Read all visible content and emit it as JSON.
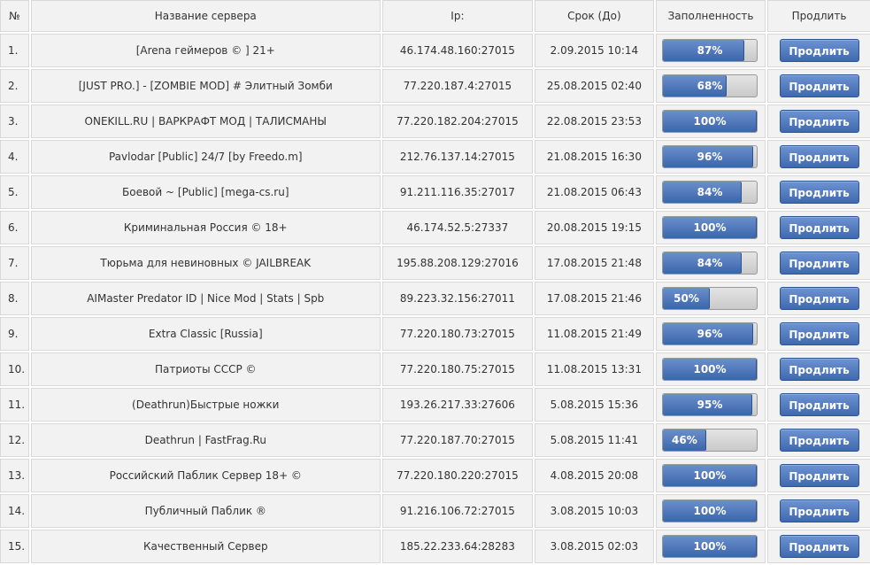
{
  "table": {
    "headers": {
      "num": "№",
      "name": "Название сервера",
      "ip": "Ip:",
      "date": "Срок (До)",
      "fill": "Заполненность",
      "extend": "Продлить"
    },
    "extend_label": "Продлить",
    "rows": [
      {
        "num": "1.",
        "name": "[Arena геймеров © ] 21+",
        "ip": "46.174.48.160:27015",
        "date": "2.09.2015 10:14",
        "fill_pct": 87,
        "fill_label": "87%"
      },
      {
        "num": "2.",
        "name": "[JUST PRO.] - [ZOMBIE MOD] # Элитный Зомби",
        "ip": "77.220.187.4:27015",
        "date": "25.08.2015 02:40",
        "fill_pct": 68,
        "fill_label": "68%"
      },
      {
        "num": "3.",
        "name": "ONEKILL.RU | ВАРКРАФТ МОД | ТАЛИСМАНЫ",
        "ip": "77.220.182.204:27015",
        "date": "22.08.2015 23:53",
        "fill_pct": 100,
        "fill_label": "100%"
      },
      {
        "num": "4.",
        "name": "Pavlodar [Public] 24/7 [by Freedo.m]",
        "ip": "212.76.137.14:27015",
        "date": "21.08.2015 16:30",
        "fill_pct": 96,
        "fill_label": "96%"
      },
      {
        "num": "5.",
        "name": "Боевой ~ [Public] [mega-cs.ru]",
        "ip": "91.211.116.35:27017",
        "date": "21.08.2015 06:43",
        "fill_pct": 84,
        "fill_label": "84%"
      },
      {
        "num": "6.",
        "name": "Криминальная Россия © 18+",
        "ip": "46.174.52.5:27337",
        "date": "20.08.2015 19:15",
        "fill_pct": 100,
        "fill_label": "100%"
      },
      {
        "num": "7.",
        "name": "Тюрьма для невиновных © JAILBREAK",
        "ip": "195.88.208.129:27016",
        "date": "17.08.2015 21:48",
        "fill_pct": 84,
        "fill_label": "84%"
      },
      {
        "num": "8.",
        "name": "AIMaster Predator ID | Nice Mod | Stats | Spb",
        "ip": "89.223.32.156:27011",
        "date": "17.08.2015 21:46",
        "fill_pct": 50,
        "fill_label": "50%"
      },
      {
        "num": "9.",
        "name": "Extra Classic [Russia]",
        "ip": "77.220.180.73:27015",
        "date": "11.08.2015 21:49",
        "fill_pct": 96,
        "fill_label": "96%"
      },
      {
        "num": "10.",
        "name": "Патриоты СССР ©",
        "ip": "77.220.180.75:27015",
        "date": "11.08.2015 13:31",
        "fill_pct": 100,
        "fill_label": "100%"
      },
      {
        "num": "11.",
        "name": "(Deathrun)Быстрые ножки",
        "ip": "193.26.217.33:27606",
        "date": "5.08.2015 15:36",
        "fill_pct": 95,
        "fill_label": "95%"
      },
      {
        "num": "12.",
        "name": "Deathrun | FastFrag.Ru",
        "ip": "77.220.187.70:27015",
        "date": "5.08.2015 11:41",
        "fill_pct": 46,
        "fill_label": "46%"
      },
      {
        "num": "13.",
        "name": "Российский Паблик Сервер 18+ ©",
        "ip": "77.220.180.220:27015",
        "date": "4.08.2015 20:08",
        "fill_pct": 100,
        "fill_label": "100%"
      },
      {
        "num": "14.",
        "name": "Публичный Паблик ®",
        "ip": "91.216.106.72:27015",
        "date": "3.08.2015 10:03",
        "fill_pct": 100,
        "fill_label": "100%"
      },
      {
        "num": "15.",
        "name": "Качественный Сервер",
        "ip": "185.22.233.64:28283",
        "date": "3.08.2015 02:03",
        "fill_pct": 100,
        "fill_label": "100%"
      }
    ]
  },
  "colors": {
    "button": "#4a72b8",
    "bar_fill": "#4a72b8",
    "bar_empty": "#d4d4d4",
    "cell_bg": "#f2f2f2",
    "cell_border": "#d8d8d8"
  }
}
